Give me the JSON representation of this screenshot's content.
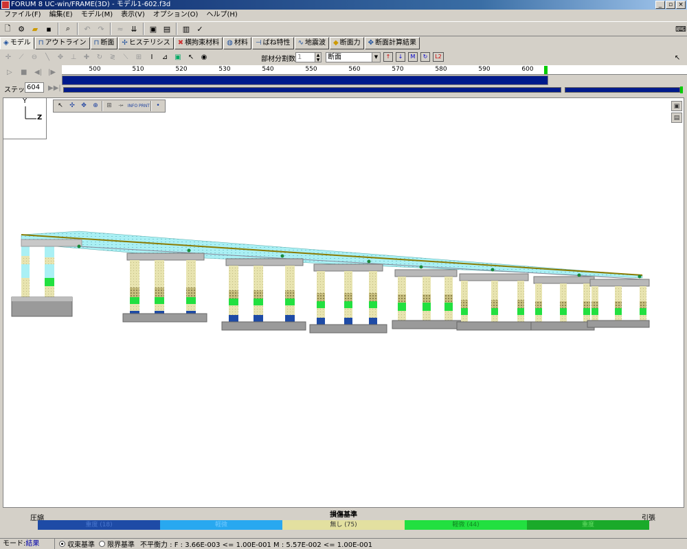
{
  "window": {
    "title": "FORUM 8  UC-win/FRAME(3D) - モデル1-602.f3d",
    "buttons": {
      "minimize": "_",
      "maximize": "▫",
      "close": "×"
    }
  },
  "menu": [
    "ファイル(F)",
    "編集(E)",
    "モデル(M)",
    "表示(V)",
    "オプション(O)",
    "ヘルプ(H)"
  ],
  "tabs": [
    {
      "label": "モデル",
      "icon": "model-icon"
    },
    {
      "label": "アウトライン",
      "icon": "outline-icon"
    },
    {
      "label": "断面",
      "icon": "section-icon"
    },
    {
      "label": "ヒステリシス",
      "icon": "hysteresis-icon"
    },
    {
      "label": "横拘束材料",
      "icon": "confine-icon"
    },
    {
      "label": "材料",
      "icon": "material-icon"
    },
    {
      "label": "ばね特性",
      "icon": "spring-icon"
    },
    {
      "label": "地震波",
      "icon": "wave-icon"
    },
    {
      "label": "断面力",
      "icon": "force-icon"
    },
    {
      "label": "断面計算結果",
      "icon": "result-icon"
    }
  ],
  "subtoolbar": {
    "split_label": "部材分割数",
    "split_value": "1",
    "display_select": "断面",
    "badge": "L2"
  },
  "animation": {
    "step_label": "ステップ*",
    "step_value": "604",
    "ruler_ticks": [
      "500",
      "510",
      "520",
      "530",
      "540",
      "550",
      "560",
      "570",
      "580",
      "590",
      "600"
    ]
  },
  "axis": {
    "y": "Y",
    "z": "Z"
  },
  "legend": {
    "title": "損傷基準",
    "left": "圧縮",
    "right": "引張",
    "segments": [
      {
        "label": "重度 (18)",
        "color": "#1e4ba6",
        "text": "#4a78d0"
      },
      {
        "label": "軽微",
        "color": "#28a8f0",
        "text": "#6fc8ff"
      },
      {
        "label": "無し (75)",
        "color": "#e3e0a0",
        "text": "#333333"
      },
      {
        "label": "軽微 (44)",
        "color": "#22e040",
        "text": "#118822"
      },
      {
        "label": "重度",
        "color": "#1aaa2a",
        "text": "#66dd66"
      }
    ]
  },
  "status": {
    "mode_label": "モード:",
    "mode_value": "結果",
    "radio1": "収束基準",
    "radio2": "限界基準",
    "imbalance": "不平衡力 : F : 3.66E-003 <= 1.00E-001  M : 5.57E-002 <= 1.00E-001"
  }
}
